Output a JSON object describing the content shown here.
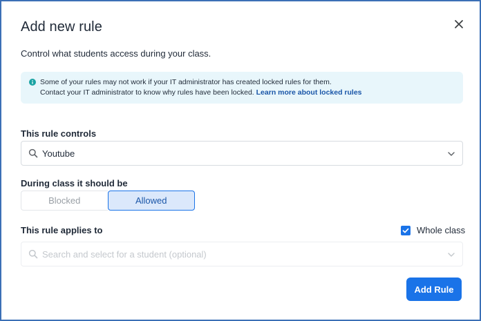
{
  "dialog": {
    "title": "Add new rule",
    "subtitle": "Control what students access during your class."
  },
  "info": {
    "icon": "info-icon",
    "line1": "Some of your rules may not work if your IT administrator has created locked rules for them.",
    "line2": "Contact your IT administrator to know why rules have been locked.",
    "link": "Learn more about locked rules"
  },
  "controls": {
    "label": "This rule controls",
    "value": "Youtube"
  },
  "during": {
    "label": "During class it should be",
    "options": [
      "Blocked",
      "Allowed"
    ],
    "selected": "Allowed"
  },
  "applies": {
    "label": "This rule applies to",
    "whole_class_label": "Whole class",
    "whole_class_checked": true,
    "student_placeholder": "Search and select for a student (optional)"
  },
  "actions": {
    "submit_label": "Add Rule"
  },
  "colors": {
    "accent": "#1a73e8",
    "info_bg": "#e8f6fb",
    "link": "#1a56a8",
    "info_icon": "#1aa3a3"
  }
}
